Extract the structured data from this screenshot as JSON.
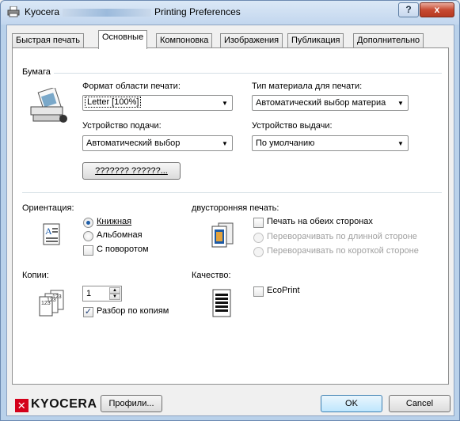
{
  "window": {
    "title_left": "Kyocera",
    "title_right": "Printing Preferences",
    "help_label": "?",
    "close_label": "x"
  },
  "tabs": [
    {
      "label": "Быстрая печать"
    },
    {
      "label": "Основные"
    },
    {
      "label": "Компоновка"
    },
    {
      "label": "Изображения"
    },
    {
      "label": "Публикация"
    },
    {
      "label": "Дополнительно"
    }
  ],
  "paper": {
    "group_label": "Бумага",
    "print_size_label": "Формат области печати:",
    "print_size_value": "Letter [100%]",
    "media_type_label": "Тип материала для печати:",
    "media_type_value": "Автоматический выбор материа",
    "source_label": "Устройство подачи:",
    "source_value": "Автоматический выбор",
    "output_label": "Устройство выдачи:",
    "output_value": "По умолчанию",
    "button_label": "??????? ??????..."
  },
  "orientation": {
    "label": "Ориентация:",
    "portrait": "Книжная",
    "landscape": "Альбомная",
    "rotate": "С поворотом"
  },
  "duplex": {
    "label": "двусторонняя печать:",
    "both_sides": "Печать на обеих сторонах",
    "long_edge": "Переворачивать по длинной стороне",
    "short_edge": "Переворачивать по короткой стороне"
  },
  "copies": {
    "label": "Копии:",
    "value": "1",
    "collate": "Разбор по копиям"
  },
  "quality": {
    "label": "Качество:",
    "ecoprint": "EcoPrint"
  },
  "footer": {
    "brand": "KYOCERA",
    "profiles_button": "Профили...",
    "ok_button": "OK",
    "cancel_button": "Cancel"
  }
}
